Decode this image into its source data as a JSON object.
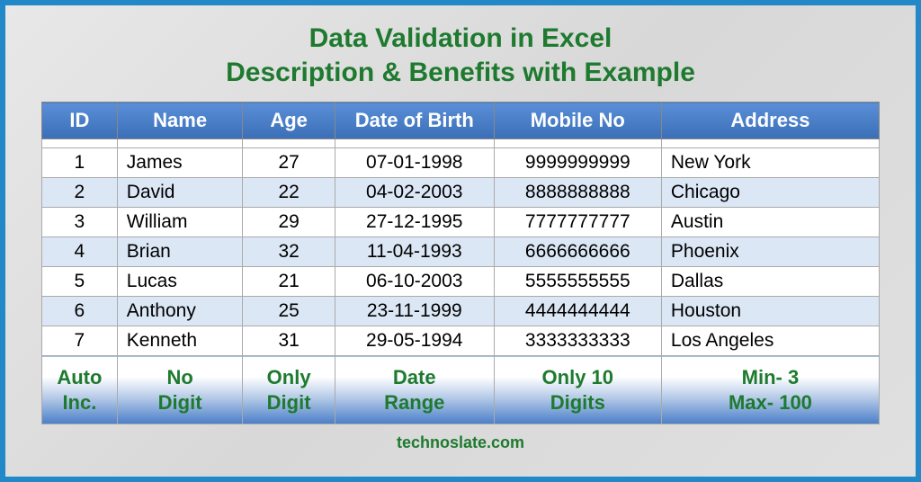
{
  "title_line1": "Data Validation in Excel",
  "title_line2": "Description & Benefits with Example",
  "headers": {
    "id": "ID",
    "name": "Name",
    "age": "Age",
    "dob": "Date of Birth",
    "mobile": "Mobile No",
    "address": "Address"
  },
  "rows": [
    {
      "id": "1",
      "name": "James",
      "age": "27",
      "dob": "07-01-1998",
      "mobile": "9999999999",
      "address": "New York"
    },
    {
      "id": "2",
      "name": "David",
      "age": "22",
      "dob": "04-02-2003",
      "mobile": "8888888888",
      "address": "Chicago"
    },
    {
      "id": "3",
      "name": "William",
      "age": "29",
      "dob": "27-12-1995",
      "mobile": "7777777777",
      "address": "Austin"
    },
    {
      "id": "4",
      "name": "Brian",
      "age": "32",
      "dob": "11-04-1993",
      "mobile": "6666666666",
      "address": "Phoenix"
    },
    {
      "id": "5",
      "name": "Lucas",
      "age": "21",
      "dob": "06-10-2003",
      "mobile": "5555555555",
      "address": "Dallas"
    },
    {
      "id": "6",
      "name": "Anthony",
      "age": "25",
      "dob": "23-11-1999",
      "mobile": "4444444444",
      "address": "Houston"
    },
    {
      "id": "7",
      "name": "Kenneth",
      "age": "31",
      "dob": "29-05-1994",
      "mobile": "3333333333",
      "address": "Los Angeles"
    }
  ],
  "validation": {
    "id": "Auto\nInc.",
    "name": "No\nDigit",
    "age": "Only\nDigit",
    "dob": "Date\nRange",
    "mobile": "Only 10\nDigits",
    "address": "Min- 3\nMax- 100"
  },
  "site": "technoslate.com"
}
